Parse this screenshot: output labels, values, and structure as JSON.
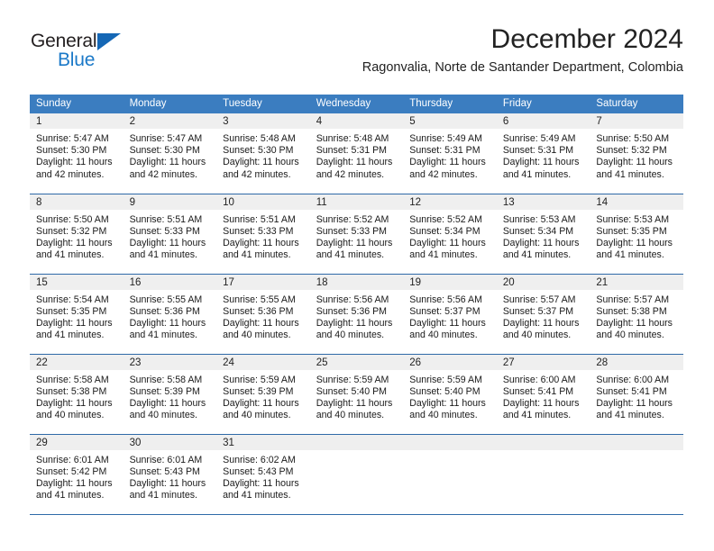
{
  "brand": {
    "name_top": "General",
    "name_bottom": "Blue",
    "accent_color": "#1b79c8",
    "triangle_color": "#1567b5"
  },
  "header": {
    "title": "December 2024",
    "subtitle": "Ragonvalia, Norte de Santander Department, Colombia"
  },
  "theme": {
    "header_row_bg": "#3b7dc0",
    "day_band_bg": "#efefef",
    "row_divider": "#2f6aa8",
    "text_color": "#222222"
  },
  "weekday_headers": [
    "Sunday",
    "Monday",
    "Tuesday",
    "Wednesday",
    "Thursday",
    "Friday",
    "Saturday"
  ],
  "labels": {
    "sunrise_prefix": "Sunrise:",
    "sunset_prefix": "Sunset:",
    "daylight_prefix": "Daylight:"
  },
  "weeks": [
    [
      {
        "day": "1",
        "sunrise": "Sunrise: 5:47 AM",
        "sunset": "Sunset: 5:30 PM",
        "daylight": "Daylight: 11 hours and 42 minutes."
      },
      {
        "day": "2",
        "sunrise": "Sunrise: 5:47 AM",
        "sunset": "Sunset: 5:30 PM",
        "daylight": "Daylight: 11 hours and 42 minutes."
      },
      {
        "day": "3",
        "sunrise": "Sunrise: 5:48 AM",
        "sunset": "Sunset: 5:30 PM",
        "daylight": "Daylight: 11 hours and 42 minutes."
      },
      {
        "day": "4",
        "sunrise": "Sunrise: 5:48 AM",
        "sunset": "Sunset: 5:31 PM",
        "daylight": "Daylight: 11 hours and 42 minutes."
      },
      {
        "day": "5",
        "sunrise": "Sunrise: 5:49 AM",
        "sunset": "Sunset: 5:31 PM",
        "daylight": "Daylight: 11 hours and 42 minutes."
      },
      {
        "day": "6",
        "sunrise": "Sunrise: 5:49 AM",
        "sunset": "Sunset: 5:31 PM",
        "daylight": "Daylight: 11 hours and 41 minutes."
      },
      {
        "day": "7",
        "sunrise": "Sunrise: 5:50 AM",
        "sunset": "Sunset: 5:32 PM",
        "daylight": "Daylight: 11 hours and 41 minutes."
      }
    ],
    [
      {
        "day": "8",
        "sunrise": "Sunrise: 5:50 AM",
        "sunset": "Sunset: 5:32 PM",
        "daylight": "Daylight: 11 hours and 41 minutes."
      },
      {
        "day": "9",
        "sunrise": "Sunrise: 5:51 AM",
        "sunset": "Sunset: 5:33 PM",
        "daylight": "Daylight: 11 hours and 41 minutes."
      },
      {
        "day": "10",
        "sunrise": "Sunrise: 5:51 AM",
        "sunset": "Sunset: 5:33 PM",
        "daylight": "Daylight: 11 hours and 41 minutes."
      },
      {
        "day": "11",
        "sunrise": "Sunrise: 5:52 AM",
        "sunset": "Sunset: 5:33 PM",
        "daylight": "Daylight: 11 hours and 41 minutes."
      },
      {
        "day": "12",
        "sunrise": "Sunrise: 5:52 AM",
        "sunset": "Sunset: 5:34 PM",
        "daylight": "Daylight: 11 hours and 41 minutes."
      },
      {
        "day": "13",
        "sunrise": "Sunrise: 5:53 AM",
        "sunset": "Sunset: 5:34 PM",
        "daylight": "Daylight: 11 hours and 41 minutes."
      },
      {
        "day": "14",
        "sunrise": "Sunrise: 5:53 AM",
        "sunset": "Sunset: 5:35 PM",
        "daylight": "Daylight: 11 hours and 41 minutes."
      }
    ],
    [
      {
        "day": "15",
        "sunrise": "Sunrise: 5:54 AM",
        "sunset": "Sunset: 5:35 PM",
        "daylight": "Daylight: 11 hours and 41 minutes."
      },
      {
        "day": "16",
        "sunrise": "Sunrise: 5:55 AM",
        "sunset": "Sunset: 5:36 PM",
        "daylight": "Daylight: 11 hours and 41 minutes."
      },
      {
        "day": "17",
        "sunrise": "Sunrise: 5:55 AM",
        "sunset": "Sunset: 5:36 PM",
        "daylight": "Daylight: 11 hours and 40 minutes."
      },
      {
        "day": "18",
        "sunrise": "Sunrise: 5:56 AM",
        "sunset": "Sunset: 5:36 PM",
        "daylight": "Daylight: 11 hours and 40 minutes."
      },
      {
        "day": "19",
        "sunrise": "Sunrise: 5:56 AM",
        "sunset": "Sunset: 5:37 PM",
        "daylight": "Daylight: 11 hours and 40 minutes."
      },
      {
        "day": "20",
        "sunrise": "Sunrise: 5:57 AM",
        "sunset": "Sunset: 5:37 PM",
        "daylight": "Daylight: 11 hours and 40 minutes."
      },
      {
        "day": "21",
        "sunrise": "Sunrise: 5:57 AM",
        "sunset": "Sunset: 5:38 PM",
        "daylight": "Daylight: 11 hours and 40 minutes."
      }
    ],
    [
      {
        "day": "22",
        "sunrise": "Sunrise: 5:58 AM",
        "sunset": "Sunset: 5:38 PM",
        "daylight": "Daylight: 11 hours and 40 minutes."
      },
      {
        "day": "23",
        "sunrise": "Sunrise: 5:58 AM",
        "sunset": "Sunset: 5:39 PM",
        "daylight": "Daylight: 11 hours and 40 minutes."
      },
      {
        "day": "24",
        "sunrise": "Sunrise: 5:59 AM",
        "sunset": "Sunset: 5:39 PM",
        "daylight": "Daylight: 11 hours and 40 minutes."
      },
      {
        "day": "25",
        "sunrise": "Sunrise: 5:59 AM",
        "sunset": "Sunset: 5:40 PM",
        "daylight": "Daylight: 11 hours and 40 minutes."
      },
      {
        "day": "26",
        "sunrise": "Sunrise: 5:59 AM",
        "sunset": "Sunset: 5:40 PM",
        "daylight": "Daylight: 11 hours and 40 minutes."
      },
      {
        "day": "27",
        "sunrise": "Sunrise: 6:00 AM",
        "sunset": "Sunset: 5:41 PM",
        "daylight": "Daylight: 11 hours and 41 minutes."
      },
      {
        "day": "28",
        "sunrise": "Sunrise: 6:00 AM",
        "sunset": "Sunset: 5:41 PM",
        "daylight": "Daylight: 11 hours and 41 minutes."
      }
    ],
    [
      {
        "day": "29",
        "sunrise": "Sunrise: 6:01 AM",
        "sunset": "Sunset: 5:42 PM",
        "daylight": "Daylight: 11 hours and 41 minutes."
      },
      {
        "day": "30",
        "sunrise": "Sunrise: 6:01 AM",
        "sunset": "Sunset: 5:43 PM",
        "daylight": "Daylight: 11 hours and 41 minutes."
      },
      {
        "day": "31",
        "sunrise": "Sunrise: 6:02 AM",
        "sunset": "Sunset: 5:43 PM",
        "daylight": "Daylight: 11 hours and 41 minutes."
      },
      {
        "day": "",
        "sunrise": "",
        "sunset": "",
        "daylight": ""
      },
      {
        "day": "",
        "sunrise": "",
        "sunset": "",
        "daylight": ""
      },
      {
        "day": "",
        "sunrise": "",
        "sunset": "",
        "daylight": ""
      },
      {
        "day": "",
        "sunrise": "",
        "sunset": "",
        "daylight": ""
      }
    ]
  ]
}
